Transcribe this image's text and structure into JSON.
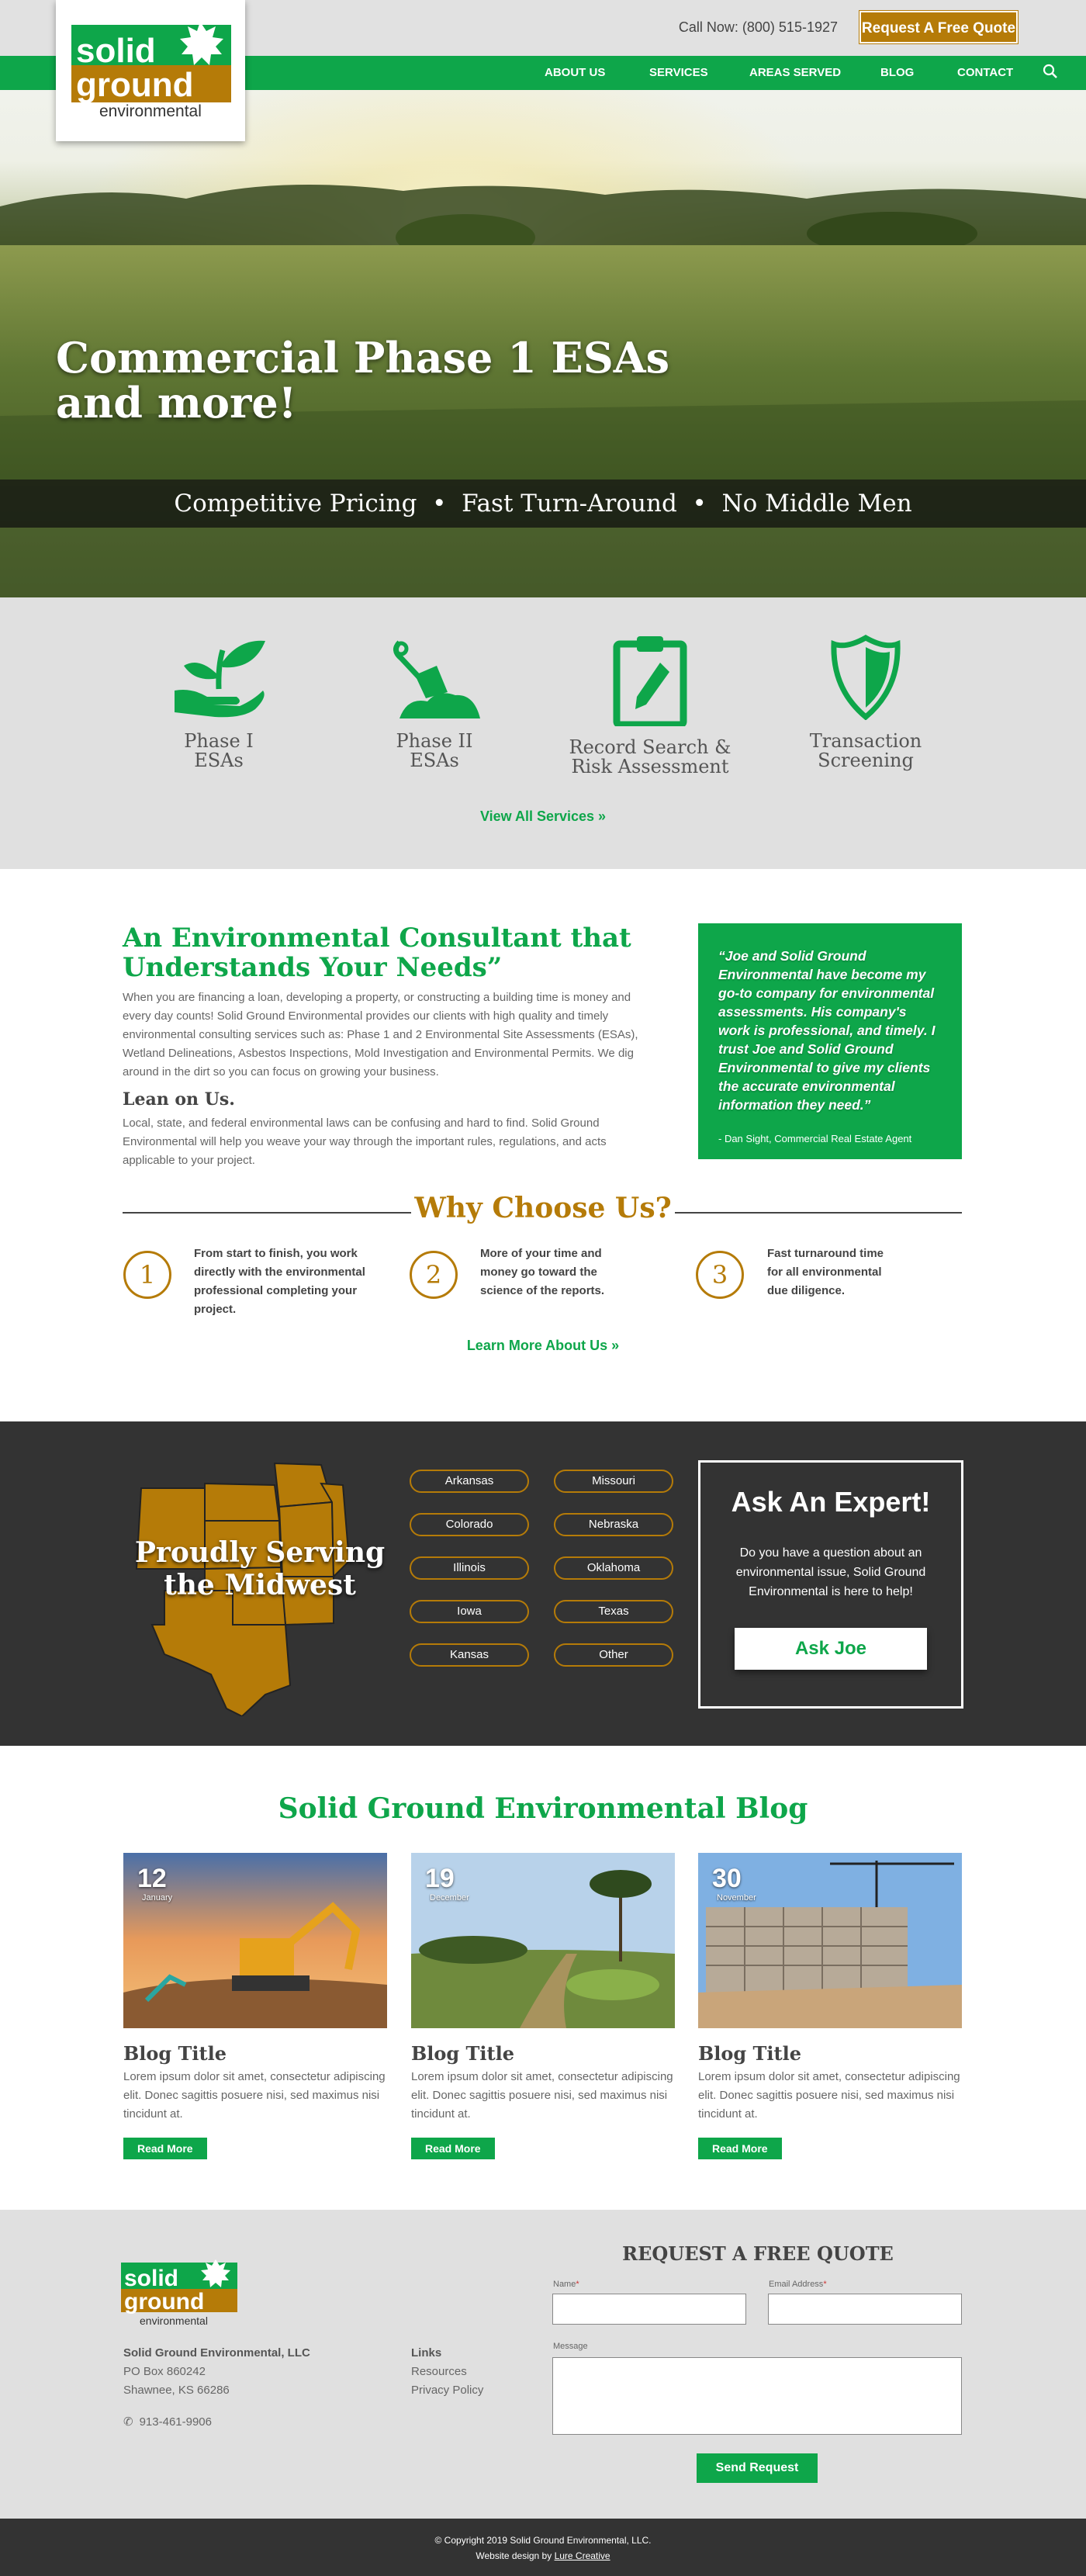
{
  "header": {
    "call_now": "Call Now: (800) 515-1927",
    "quote_button": "Request A Free Quote",
    "logo_line1": "solid",
    "logo_line2": "ground",
    "logo_line3": "environmental"
  },
  "nav": {
    "items": [
      "ABOUT US",
      "SERVICES",
      "AREAS SERVED",
      "BLOG",
      "CONTACT"
    ]
  },
  "hero": {
    "title_line1": "Commercial Phase 1 ESAs",
    "title_line2": "and more!",
    "strip": "Competitive Pricing  •  Fast Turn-Around  •  No Middle Men"
  },
  "services": {
    "items": [
      {
        "line1": "Phase I",
        "line2": "ESAs",
        "icon": "plant-hand-icon"
      },
      {
        "line1": "Phase II",
        "line2": "ESAs",
        "icon": "trowel-icon"
      },
      {
        "line1": "Record Search &",
        "line2": "Risk Assessment",
        "icon": "clipboard-icon"
      },
      {
        "line1": "Transaction",
        "line2": "Screening",
        "icon": "shield-icon"
      }
    ],
    "view_all": "View All Services »"
  },
  "about": {
    "title": "An Environmental Consultant that Understands Your Needs”",
    "para1": "When you are financing a loan, developing a property, or constructing a building time is money and every day counts! Solid Ground Environmental provides our clients with high quality and timely environmental consulting services such as: Phase 1 and 2 Environmental Site Assessments (ESAs), Wetland Delineations, Asbestos Inspections, Mold Investigation and Environmental Permits. We dig around in the dirt so you can focus on growing your business.",
    "lean_title": "Lean on Us.",
    "para2": "Local, state, and federal environmental laws can be confusing and hard to find. Solid Ground Environmental will help you weave your way through the important rules, regulations, and acts applicable to your project."
  },
  "testimonial": {
    "quote": "“Joe and Solid Ground Environmental have become my go-to company for environmental assessments. His company's work is professional, and timely. I trust Joe and Solid Ground Environmental to give my clients the accurate environmental information they need.”",
    "author": "- Dan Sight, Commercial Real Estate Agent"
  },
  "why": {
    "title": "Why Choose Us?",
    "items": [
      {
        "num": "1",
        "text": "From start to finish, you work directly with the environmental professional completing your project."
      },
      {
        "num": "2",
        "text": "More of your time and money go toward the science of the reports."
      },
      {
        "num": "3",
        "text": "Fast turnaround time for all environmental due diligence."
      }
    ],
    "learn_more": "Learn More About Us »"
  },
  "midwest": {
    "title": "Proudly Serving the Midwest",
    "states": [
      "Arkansas",
      "Missouri",
      "Colorado",
      "Nebraska",
      "Illinois",
      "Oklahoma",
      "Iowa",
      "Texas",
      "Kansas",
      "Other"
    ],
    "expert_title": "Ask An Expert!",
    "expert_text": "Do you have a question about an environmental issue, Solid Ground Environmental is here to help!",
    "expert_button": "Ask Joe"
  },
  "blog": {
    "title": "Solid Ground Environmental Blog",
    "posts": [
      {
        "day": "12",
        "month": "January",
        "title": "Blog Title",
        "body": "Lorem ipsum dolor sit amet, consectetur adipiscing elit. Donec sagittis posuere nisi, sed maximus nisi tincidunt at.",
        "button": "Read More"
      },
      {
        "day": "19",
        "month": "December",
        "title": "Blog Title",
        "body": "Lorem ipsum dolor sit amet, consectetur adipiscing elit. Donec sagittis posuere nisi, sed maximus nisi tincidunt at.",
        "button": "Read More"
      },
      {
        "day": "30",
        "month": "November",
        "title": "Blog Title",
        "body": "Lorem ipsum dolor sit amet, consectetur adipiscing elit. Donec sagittis posuere nisi, sed maximus nisi tincidunt at.",
        "button": "Read More"
      }
    ]
  },
  "footer": {
    "company": "Solid Ground Environmental, LLC",
    "address1": "PO Box 860242",
    "address2": "Shawnee, KS 66286",
    "phone": "913-461-9906",
    "links_title": "Links",
    "links": [
      "Resources",
      "Privacy Policy"
    ],
    "form_title": "REQUEST A FREE QUOTE",
    "name_label": "Name",
    "email_label": "Email Address",
    "message_label": "Message",
    "required_mark": "*",
    "send_button": "Send Request",
    "copyright": "© Copyright 2019 Solid Ground Environmental, LLC.",
    "design_prefix": "Website design by ",
    "design_link": "Lure Creative"
  },
  "colors": {
    "green": "#0ea64a",
    "gold": "#b57b08",
    "dark": "#333333",
    "light_gray": "#e0e0e0"
  }
}
